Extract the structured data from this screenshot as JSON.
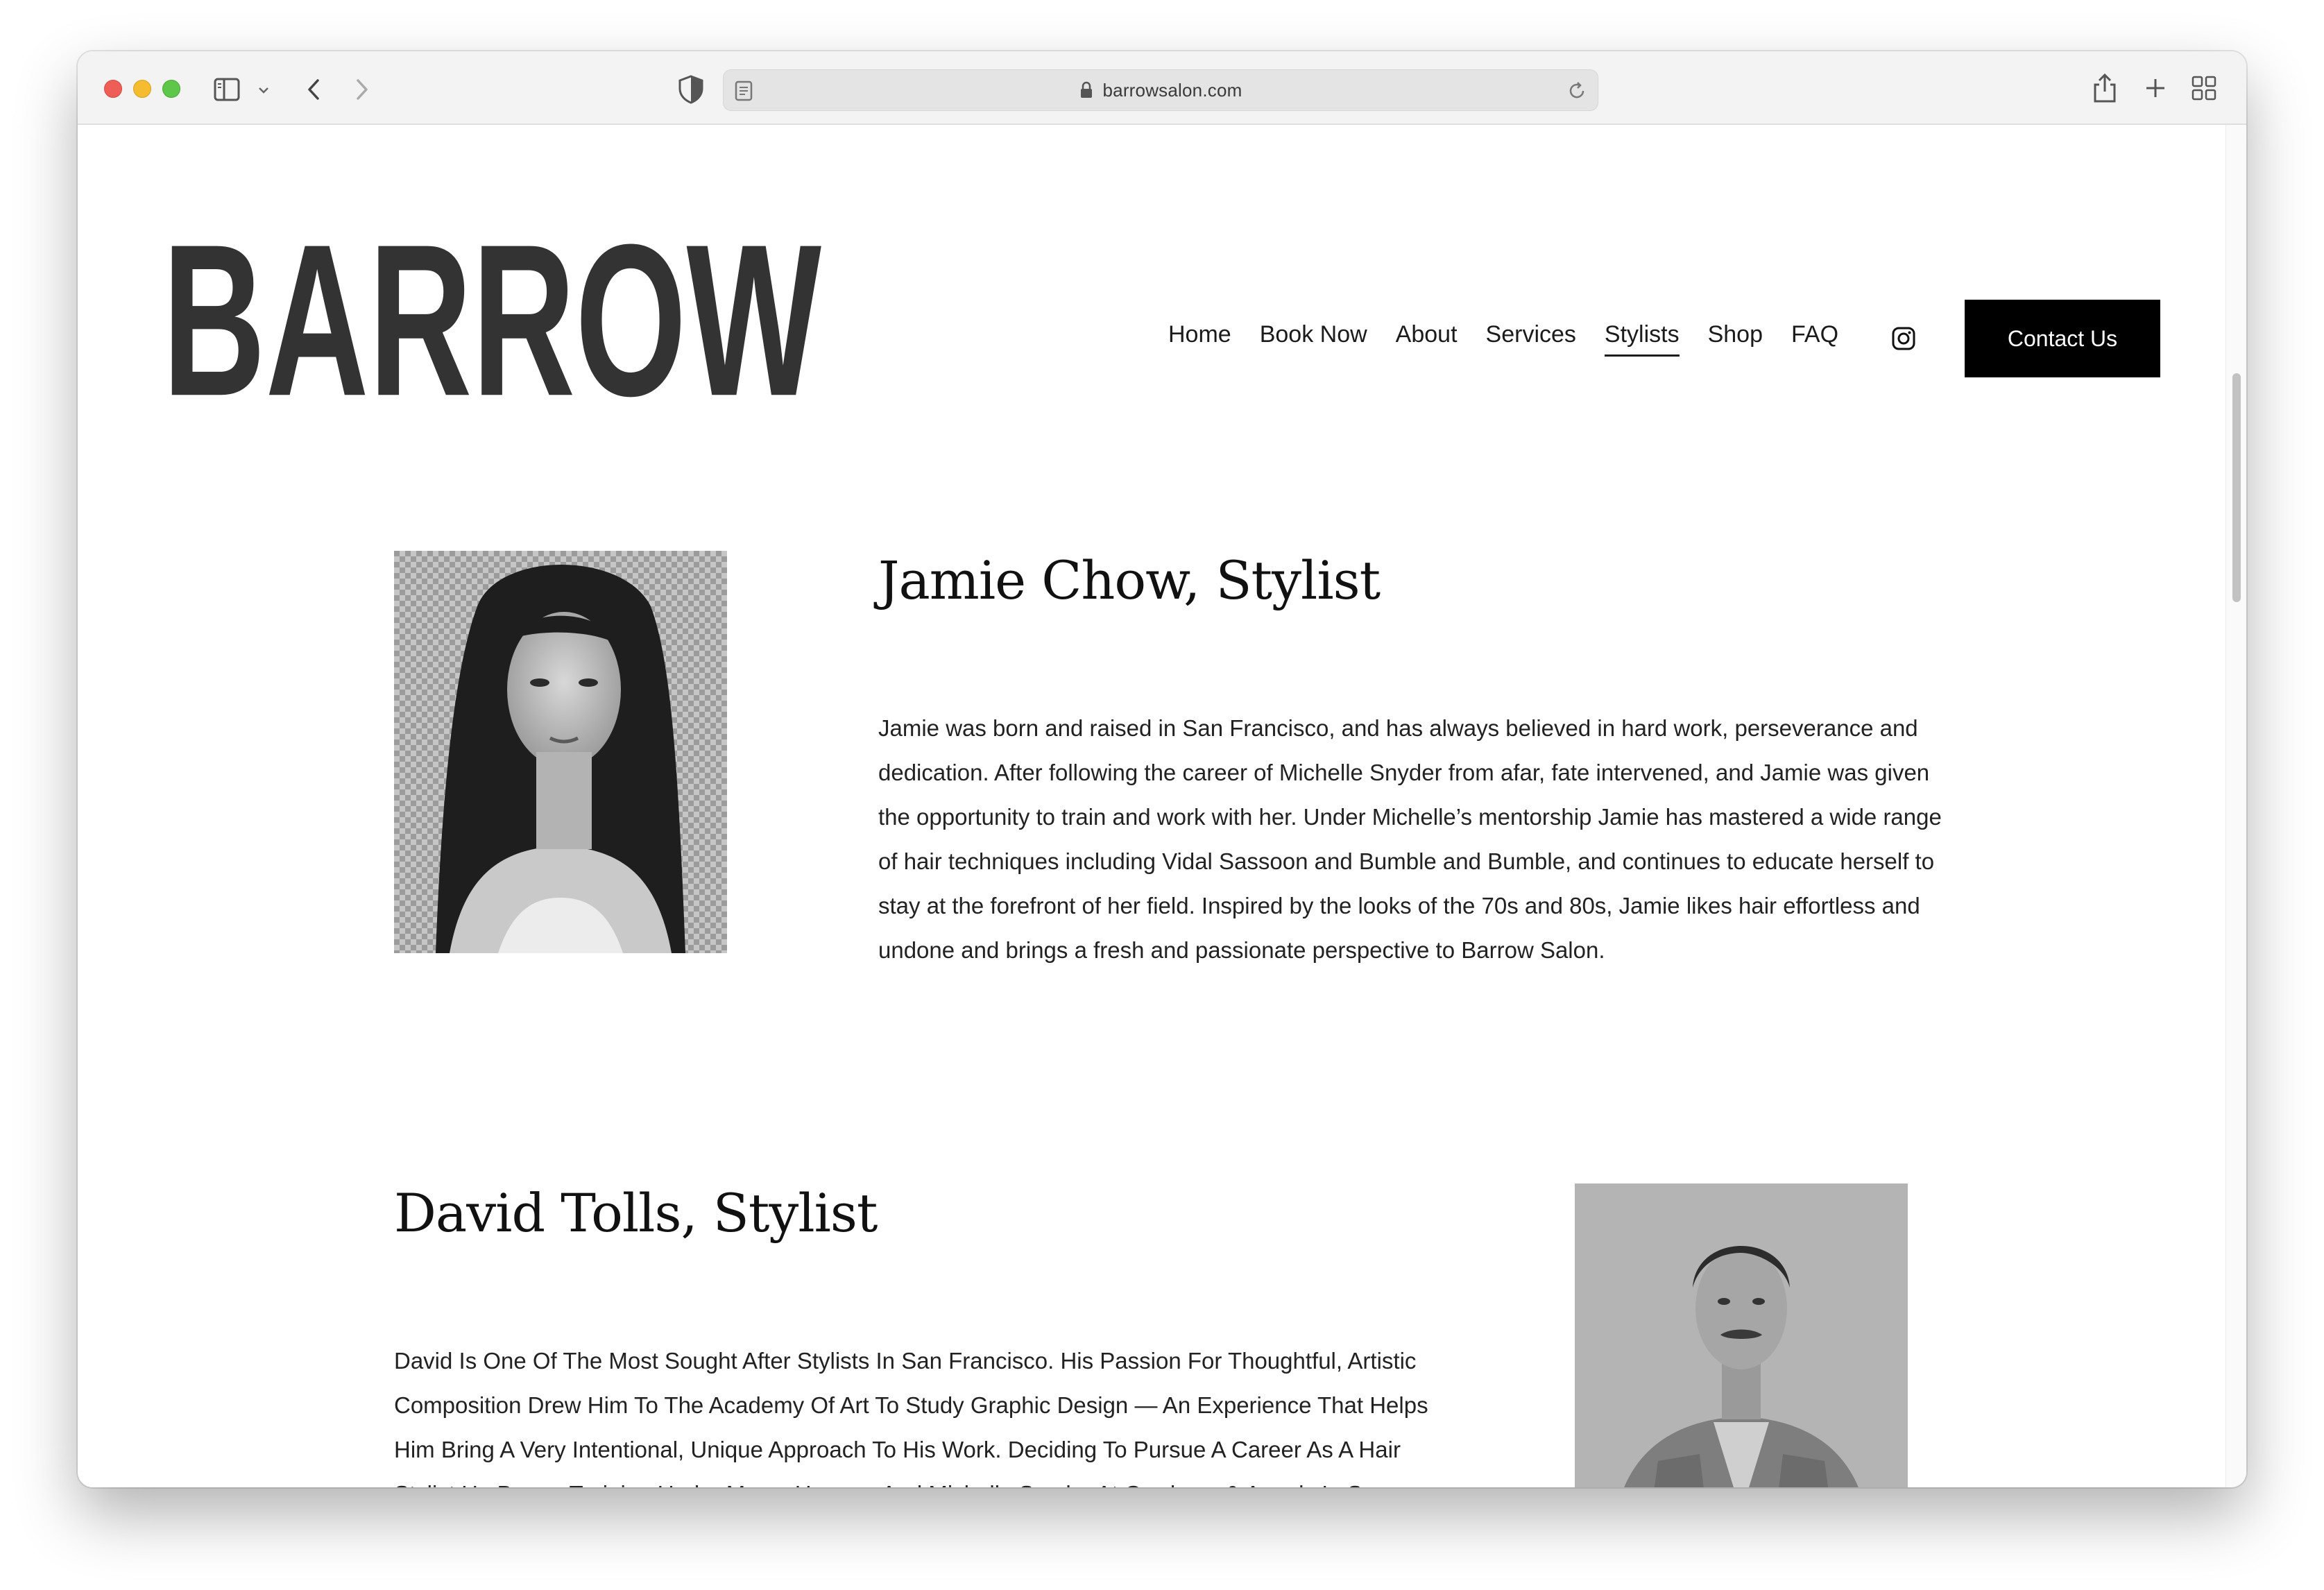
{
  "browser": {
    "url": "barrowsalon.com"
  },
  "site": {
    "logo_text": "BARROW",
    "nav": [
      {
        "label": "Home"
      },
      {
        "label": "Book Now"
      },
      {
        "label": "About"
      },
      {
        "label": "Services"
      },
      {
        "label": "Stylists",
        "active": true
      },
      {
        "label": "Shop"
      },
      {
        "label": "FAQ"
      }
    ],
    "contact_label": "Contact Us"
  },
  "stylists": [
    {
      "name": "Jamie Chow, Stylist",
      "bio": "Jamie was born and raised in San Francisco, and has always believed in hard work, perseverance and dedication. After following the career of Michelle Snyder from afar, fate intervened, and Jamie was given the opportunity to train and work with her. Under Michelle’s mentorship Jamie has mastered a wide range of hair techniques including Vidal Sassoon and Bumble and Bumble, and continues to educate herself to stay at the forefront of her field. Inspired by the looks of the 70s and 80s, Jamie likes hair effortless and undone and brings a fresh and passionate perspective to Barrow Salon."
    },
    {
      "name": "David Tolls, Stylist",
      "bio": "David Is One Of The Most Sought After Stylists In San Francisco. His Passion For Thoughtful, Artistic Composition Drew Him To The Academy Of Art To Study Graphic Design — An Experience That Helps Him Bring A Very Intentional, Unique Approach To His Work. Deciding To Pursue A Career As A Hair Stylist He Began Training Under Marcy Harmon And Michelle Snyder At Cowboys & Angels In San Francisco. Throughout His Career, David Has Always"
    }
  ]
}
